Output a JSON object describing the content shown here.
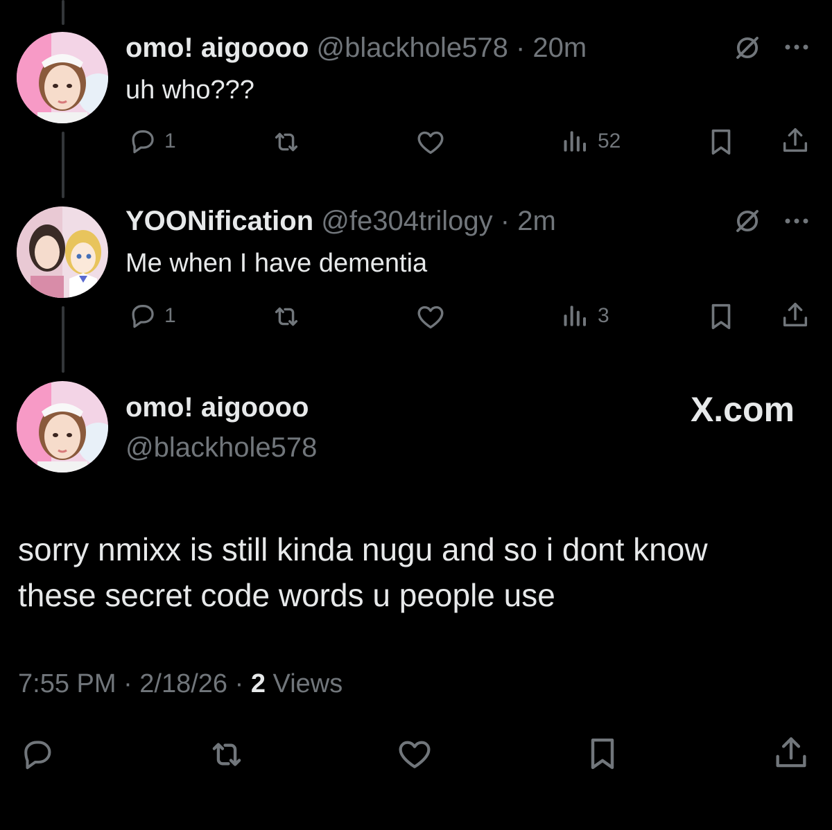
{
  "reply1": {
    "name": "omo! aigoooo",
    "meta": "@blackhole578 · 20m",
    "text": "uh who???",
    "replies": "1",
    "retweets": "",
    "likes": "",
    "views": "52"
  },
  "reply2": {
    "name": "YOONification",
    "meta": "@fe304trilogy · 2m",
    "text": "Me when I have dementia",
    "replies": "1",
    "retweets": "",
    "likes": "",
    "views": "3"
  },
  "main_post": {
    "name": "omo! aigoooo",
    "handle": "@blackhole578",
    "watermark": "X.com",
    "text_line1": "sorry nmixx is still kinda nugu and so i dont know",
    "text_line2": "these secret code words u people use",
    "time": "7:55 PM · 2/18/26 · ",
    "views_count": "2",
    "views_label": " Views"
  },
  "icons": {
    "reply": "reply-icon",
    "retweet": "retweet-icon",
    "like": "heart-icon",
    "views": "views-icon",
    "bookmark": "bookmark-icon",
    "share": "share-icon",
    "grok": "grok-icon",
    "more": "more-icon"
  },
  "colors": {
    "background": "#000000",
    "primary_text": "#e7e9ea",
    "secondary_text": "#71767b",
    "thread_line": "#333639"
  }
}
